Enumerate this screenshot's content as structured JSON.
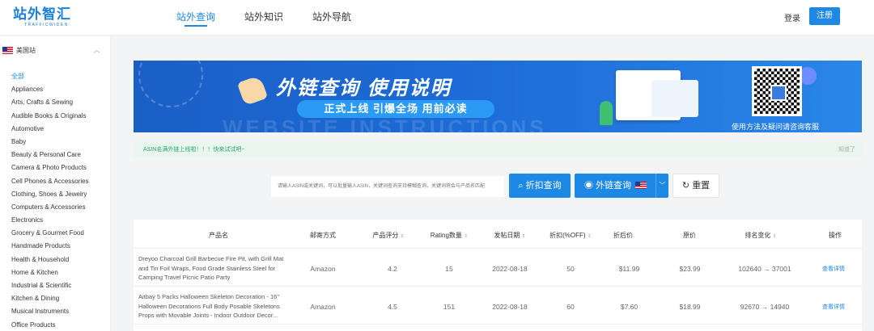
{
  "header": {
    "logo_cn": "站外智汇",
    "logo_en": "TRAFFICWIDEN",
    "nav": [
      "站外查询",
      "站外知识",
      "站外导航"
    ],
    "login": "登录",
    "register": "注册"
  },
  "sidebar": {
    "site": "美国站",
    "categories": [
      "全部",
      "Appliances",
      "Arts, Crafts & Sewing",
      "Audible Books & Originals",
      "Automotive",
      "Baby",
      "Beauty & Personal Care",
      "Camera & Photo Products",
      "Cell Phones & Accessories",
      "Clothing, Shoes & Jewelry",
      "Computers & Accessories",
      "Electronics",
      "Grocery & Gourmet Food",
      "Handmade Products",
      "Health & Household",
      "Home & Kitchen",
      "Industrial & Scientific",
      "Kitchen & Dining",
      "Musical Instruments",
      "Office Products"
    ]
  },
  "banner": {
    "title": "外链查询 使用说明",
    "subtitle": "正式上线 引爆全场 用前必读",
    "watermark": "WEBSITE INSTRUCTIONS",
    "qr_caption": "使用方法及疑问请咨询客服"
  },
  "notice": {
    "text": "ASIN名满外链上线啦！！！快来试试吧~",
    "close": "知道了"
  },
  "search": {
    "placeholder": "请输入ASIN或关键词，可以批量输入ASIN，关键词查询支持模糊查询，关键词将会与产品名匹配",
    "discount_btn": "折扣查询",
    "links_btn": "外链查询",
    "reset_btn": "重置"
  },
  "table": {
    "headers": [
      "产品名",
      "邮寄方式",
      "产品评分",
      "Rating数量",
      "发帖日期",
      "折扣(%OFF)",
      "折后价",
      "原价",
      "排名变化",
      "操作"
    ],
    "rows": [
      {
        "name": "Dreyoo Charcoal Grill Barbecue Fire Pit, with Grill Mat and Tin Foil Wraps, Food Grade Stainless Steel for Camping Travel Picnic Patio Party",
        "ship": "Amazon",
        "score": "4.2",
        "ratings": "15",
        "date": "2022-08-18",
        "discount": "50",
        "price": "$11.99",
        "orig": "$23.99",
        "rank": "102640 → 37001",
        "op": "查看详情"
      },
      {
        "name": "Aitbay 5 Packs Halloween Skeleton Decoration - 16\" Halloween Decorations Full Body Posable Skeletons Props with Movable Joints - Indoor Outdoor Decor...",
        "ship": "Amazon",
        "score": "4.5",
        "ratings": "151",
        "date": "2022-08-18",
        "discount": "60",
        "price": "$7.60",
        "orig": "$18.99",
        "rank": "92670 → 14940",
        "op": "查看详情"
      }
    ]
  }
}
